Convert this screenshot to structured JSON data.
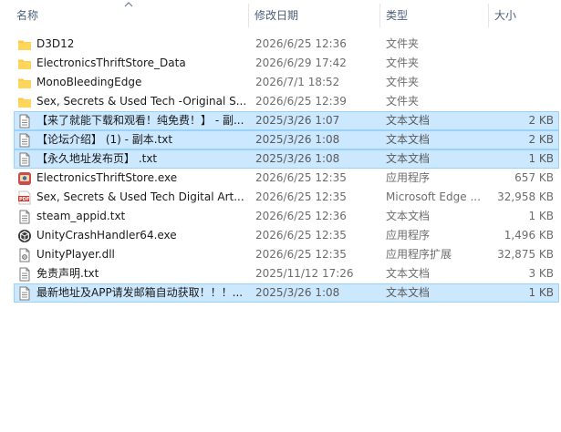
{
  "columns": {
    "name": "名称",
    "date": "修改日期",
    "type": "类型",
    "size": "大小"
  },
  "files": [
    {
      "name": "D3D12",
      "date": "2026/6/25 12:36",
      "type": "文件夹",
      "size": "",
      "icon": "folder-icon",
      "selected": false
    },
    {
      "name": "ElectronicsThriftStore_Data",
      "date": "2026/6/29 17:42",
      "type": "文件夹",
      "size": "",
      "icon": "folder-icon",
      "selected": false
    },
    {
      "name": "MonoBleedingEdge",
      "date": "2026/7/1 18:52",
      "type": "文件夹",
      "size": "",
      "icon": "folder-icon",
      "selected": false
    },
    {
      "name": "Sex, Secrets & Used Tech -Original S...",
      "date": "2026/6/25 12:39",
      "type": "文件夹",
      "size": "",
      "icon": "folder-icon",
      "selected": false
    },
    {
      "name": "【来了就能下载和观看！纯免费！】 - 副...",
      "date": "2025/3/26 1:07",
      "type": "文本文档",
      "size": "2 KB",
      "icon": "text-file-icon",
      "selected": true
    },
    {
      "name": "【论坛介绍】 (1) - 副本.txt",
      "date": "2025/3/26 1:08",
      "type": "文本文档",
      "size": "2 KB",
      "icon": "text-file-icon",
      "selected": true
    },
    {
      "name": "【永久地址发布页】 .txt",
      "date": "2025/3/26 1:08",
      "type": "文本文档",
      "size": "1 KB",
      "icon": "text-file-icon",
      "selected": true
    },
    {
      "name": "ElectronicsThriftStore.exe",
      "date": "2026/6/25 12:35",
      "type": "应用程序",
      "size": "657 KB",
      "icon": "game-exe-icon",
      "selected": false
    },
    {
      "name": "Sex, Secrets & Used Tech Digital Art...",
      "date": "2026/6/25 12:35",
      "type": "Microsoft Edge ...",
      "size": "32,958 KB",
      "icon": "pdf-icon",
      "selected": false
    },
    {
      "name": "steam_appid.txt",
      "date": "2026/6/25 12:36",
      "type": "文本文档",
      "size": "1 KB",
      "icon": "text-file-icon",
      "selected": false
    },
    {
      "name": "UnityCrashHandler64.exe",
      "date": "2026/6/25 12:35",
      "type": "应用程序",
      "size": "1,496 KB",
      "icon": "unity-icon",
      "selected": false
    },
    {
      "name": "UnityPlayer.dll",
      "date": "2026/6/25 12:35",
      "type": "应用程序扩展",
      "size": "32,875 KB",
      "icon": "dll-icon",
      "selected": false
    },
    {
      "name": "免责声明.txt",
      "date": "2025/11/12 17:26",
      "type": "文本文档",
      "size": "3 KB",
      "icon": "text-file-icon",
      "selected": false
    },
    {
      "name": "最新地址及APP请发邮箱自动获取！！！...",
      "date": "2025/3/26 1:08",
      "type": "文本文档",
      "size": "1 KB",
      "icon": "text-file-icon",
      "selected": true
    }
  ],
  "colors": {
    "selection_bg": "#cce8ff",
    "selection_border": "#99d1ff",
    "header_text": "#4c607a",
    "folder": "#ffc83d"
  }
}
